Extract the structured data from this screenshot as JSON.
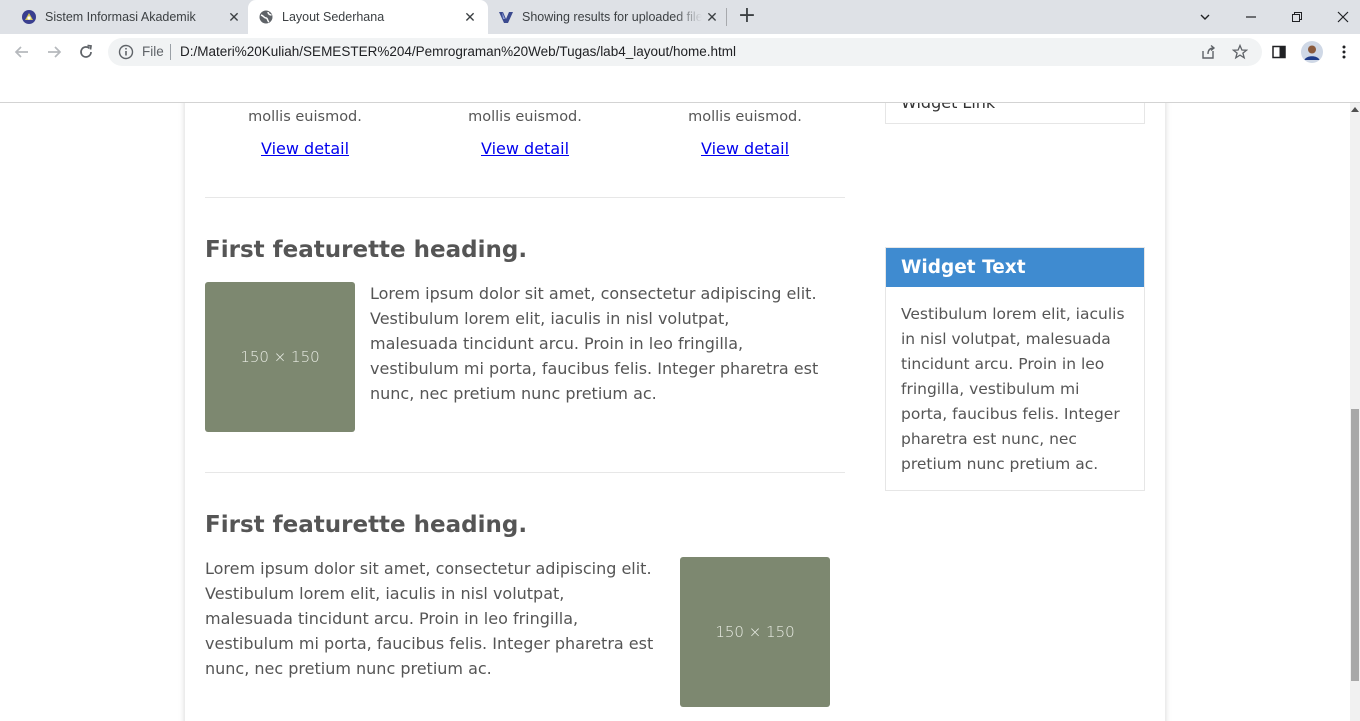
{
  "browser": {
    "tabs": [
      {
        "title": "Sistem Informasi Akademik",
        "icon": "university-logo-icon"
      },
      {
        "title": "Layout Sederhana",
        "icon": "globe-icon",
        "active": true
      },
      {
        "title": "Showing results for uploaded file",
        "icon": "search-engine-logo-icon"
      }
    ],
    "omnibox": {
      "scheme_label": "File",
      "url": "D:/Materi%20Kuliah/SEMESTER%204/Pemrograman%20Web/Tugas/lab4_layout/home.html"
    }
  },
  "page": {
    "columns": [
      {
        "text": "mollis euismod.",
        "link": "View detail"
      },
      {
        "text": "mollis euismod.",
        "link": "View detail"
      },
      {
        "text": "mollis euismod.",
        "link": "View detail"
      }
    ],
    "featurettes": [
      {
        "heading": "First featurette heading.",
        "image_label": "150 × 150",
        "text": "Lorem ipsum dolor sit amet, consectetur adipiscing elit. Vestibulum lorem elit, iaculis in nisl volutpat, malesuada tincidunt arcu. Proin in leo fringilla, vestibulum mi porta, faucibus felis. Integer pharetra est nunc, nec pretium nunc pretium ac."
      },
      {
        "heading": "First featurette heading.",
        "image_label": "150 × 150",
        "text": "Lorem ipsum dolor sit amet, consectetur adipiscing elit. Vestibulum lorem elit, iaculis in nisl volutpat, malesuada tincidunt arcu. Proin in leo fringilla, vestibulum mi porta, faucibus felis. Integer pharetra est nunc, nec pretium nunc pretium ac."
      }
    ],
    "sidebar": {
      "widget_link": "Widget Link",
      "widget_text_title": "Widget Text",
      "widget_text_body": "Vestibulum lorem elit, iaculis in nisl volutpat, malesuada tincidunt arcu. Proin in leo fringilla, vestibulum mi porta, faucibus felis. Integer pharetra est nunc, nec pretium nunc pretium ac."
    }
  },
  "colors": {
    "widget_header": "#3f8bd0",
    "placeholder_image": "#7d8870",
    "link": "#0000ee"
  }
}
